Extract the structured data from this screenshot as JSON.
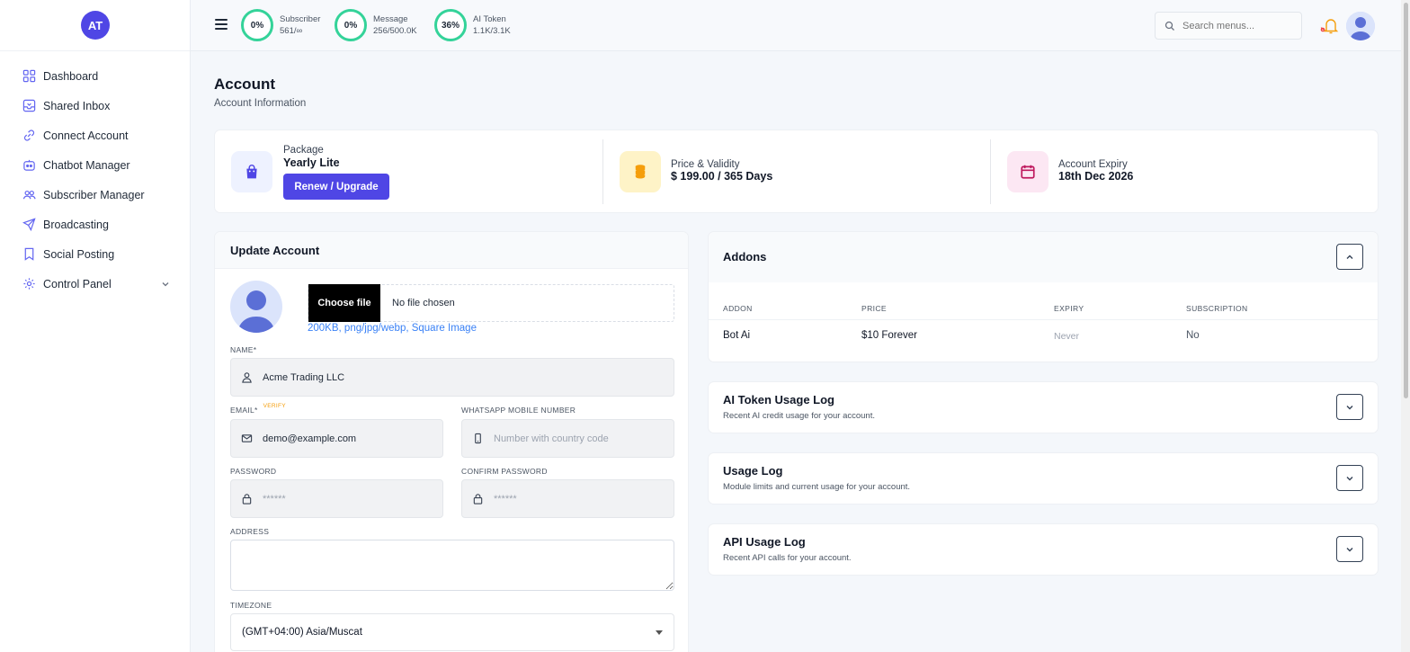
{
  "sidebar": {
    "avatar_initials": "AT",
    "items": [
      {
        "label": "Dashboard",
        "icon": "grid-icon"
      },
      {
        "label": "Shared Inbox",
        "icon": "inbox-icon"
      },
      {
        "label": "Connect Account",
        "icon": "link-icon"
      },
      {
        "label": "Chatbot Manager",
        "icon": "robot-icon"
      },
      {
        "label": "Subscriber Manager",
        "icon": "users-icon"
      },
      {
        "label": "Broadcasting",
        "icon": "send-icon"
      },
      {
        "label": "Social Posting",
        "icon": "bookmark-icon"
      },
      {
        "label": "Control Panel",
        "icon": "gear-icon"
      }
    ],
    "accent": "#6366f1"
  },
  "topbar": {
    "stats": [
      {
        "percent": "0%",
        "label": "Subscriber",
        "value": "561/∞"
      },
      {
        "percent": "0%",
        "label": "Message",
        "value": "256/500.0K"
      },
      {
        "percent": "36%",
        "label": "AI Token",
        "value": "1.1K/3.1K"
      }
    ],
    "search_placeholder": "Search menus...",
    "ring_color": "#34d399"
  },
  "page": {
    "title": "Account",
    "subtitle": "Account Information"
  },
  "summary": {
    "package_label": "Package",
    "package_value": "Yearly Lite",
    "renew_label": "Renew / Upgrade",
    "price_label": "Price & Validity",
    "price_value": "$ 199.00 / 365 Days",
    "expiry_label": "Account Expiry",
    "expiry_value": "18th Dec 2026"
  },
  "update_account": {
    "title": "Update Account",
    "choose_file_label": "Choose file",
    "file_status": "No file chosen",
    "file_hint": "200KB, png/jpg/webp, Square Image",
    "name_label": "NAME*",
    "name_value": "Acme Trading LLC",
    "email_label": "EMAIL*",
    "verify_label": "VERIFY",
    "email_value": "demo@example.com",
    "whatsapp_label": "WHATSAPP MOBILE NUMBER",
    "whatsapp_placeholder": "Number with country code",
    "password_label": "PASSWORD",
    "password_placeholder": "******",
    "confirm_password_label": "CONFIRM PASSWORD",
    "confirm_password_placeholder": "******",
    "address_label": "ADDRESS",
    "timezone_label": "TIMEZONE",
    "timezone_value": "(GMT+04:00) Asia/Muscat"
  },
  "addons": {
    "title": "Addons",
    "columns": [
      "ADDON",
      "PRICE",
      "EXPIRY",
      "SUBSCRIPTION"
    ],
    "rows": [
      {
        "addon": "Bot Ai",
        "price": "$10 Forever",
        "expiry": "Never",
        "subscription": "No"
      }
    ]
  },
  "logs": [
    {
      "title": "AI Token Usage Log",
      "subtitle": "Recent AI credit usage for your account."
    },
    {
      "title": "Usage Log",
      "subtitle": "Module limits and current usage for your account."
    },
    {
      "title": "API Usage Log",
      "subtitle": "Recent API calls for your account."
    }
  ],
  "colors": {
    "primary": "#4f46e5",
    "package_icon_bg": "#eef2ff",
    "price_icon_bg": "#fef3c7",
    "expiry_icon_bg": "#fce7f3"
  }
}
